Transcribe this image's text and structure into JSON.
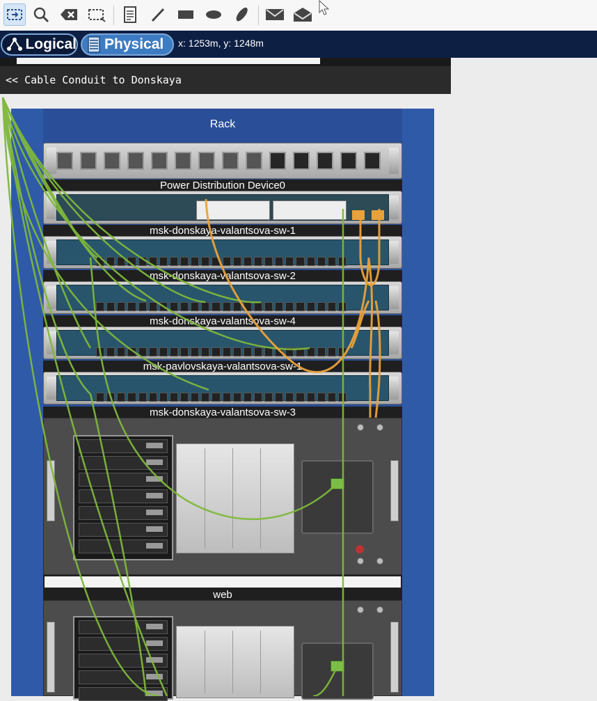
{
  "toolbar": {
    "tools": [
      {
        "icon": "select-icon",
        "active": true
      },
      {
        "icon": "inspect-icon"
      },
      {
        "icon": "delete-icon"
      },
      {
        "icon": "resize-icon"
      },
      {
        "icon": "note-icon"
      },
      {
        "icon": "draw-line-icon"
      },
      {
        "icon": "rectangle-icon"
      },
      {
        "icon": "ellipse-icon"
      },
      {
        "icon": "freeform-icon"
      },
      {
        "icon": "simple-pdu-icon"
      },
      {
        "icon": "complex-pdu-icon"
      }
    ]
  },
  "modebar": {
    "logical_label": "Logical",
    "physical_label": "Physical",
    "coordinates": "x: 1253m, y: 1248m"
  },
  "conduit": {
    "label": "<< Cable Conduit to Donskaya"
  },
  "rack": {
    "title": "Rack",
    "devices": [
      {
        "label": "Power Distribution Device0"
      },
      {
        "label": "msk-donskaya-valantsova-sw-1"
      },
      {
        "label": "msk-donskaya-valantsova-sw-2"
      },
      {
        "label": "msk-donskaya-valantsova-sw-4"
      },
      {
        "label": "msk-pavlovskaya-valantsova-sw-1"
      },
      {
        "label": "msk-donskaya-valantsova-sw-3"
      },
      {
        "label": "web"
      }
    ]
  },
  "colors": {
    "copper_cable": "#7fb83c",
    "fiber_cable": "#e9a23b",
    "rack_blue": "#2f5aa8",
    "mode_bar": "#0e1f44"
  }
}
